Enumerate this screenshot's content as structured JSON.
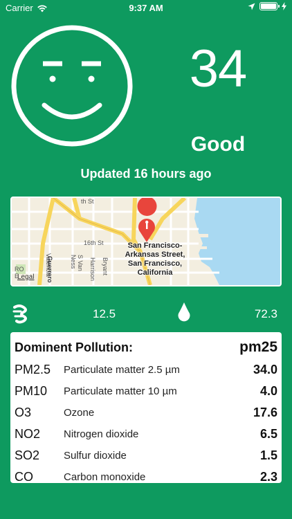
{
  "status_bar": {
    "carrier": "Carrier",
    "time": "9:37 AM",
    "battery_level": 1.0
  },
  "air_quality": {
    "aqi": "34",
    "level": "Good",
    "updated": "Updated 16 hours ago",
    "face_icon": "smiley-face-icon"
  },
  "map": {
    "location_label": "San Francisco-Arkansas Street, San Francisco, California",
    "legal": "Legal",
    "streets": [
      "16th St",
      "S Van Ness",
      "Valencia",
      "Guerrero",
      "Harrison",
      "Bryant",
      "th St",
      "RO",
      "E"
    ]
  },
  "weather": {
    "wind_icon": "wind-icon",
    "wind": "12.5",
    "humidity_icon": "water-drop-icon",
    "humidity": "72.3"
  },
  "pollution": {
    "title": "Dominent Pollution:",
    "dominant": "pm25",
    "rows": [
      {
        "code": "PM2.5",
        "desc": "Particulate matter 2.5 µm",
        "value": "34.0"
      },
      {
        "code": "PM10",
        "desc": "Particulate matter 10 µm",
        "value": "4.0"
      },
      {
        "code": "O3",
        "desc": "Ozone",
        "value": "17.6"
      },
      {
        "code": "NO2",
        "desc": "Nitrogen dioxide",
        "value": "6.5"
      },
      {
        "code": "SO2",
        "desc": "Sulfur dioxide",
        "value": "1.5"
      },
      {
        "code": "CO",
        "desc": "Carbon monoxide",
        "value": "2.3"
      }
    ]
  },
  "colors": {
    "background": "#0e9a5f",
    "card": "#ffffff",
    "water": "#a9d9f2",
    "pin": "#e8453c"
  }
}
